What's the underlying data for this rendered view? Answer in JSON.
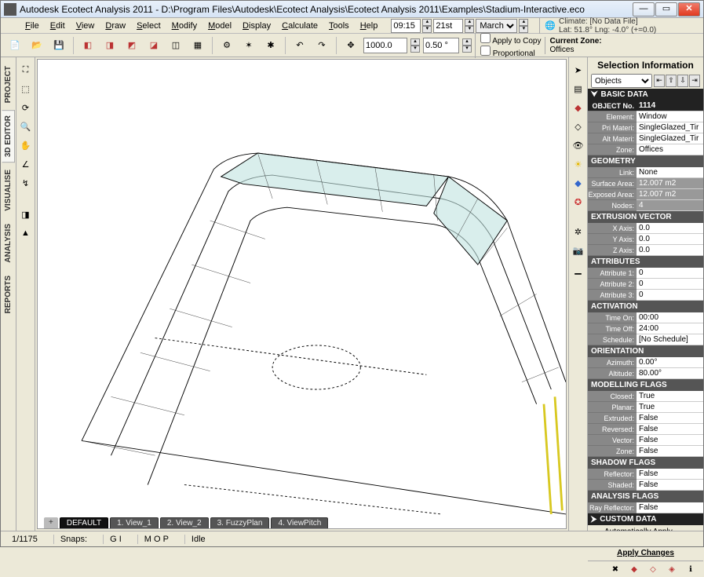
{
  "window": {
    "title": "Autodesk Ecotect Analysis 2011 - D:\\Program Files\\Autodesk\\Ecotect Analysis\\Ecotect Analysis 2011\\Examples\\Stadium-Interactive.eco"
  },
  "menu": {
    "items": [
      "File",
      "Edit",
      "View",
      "Draw",
      "Select",
      "Modify",
      "Model",
      "Display",
      "Calculate",
      "Tools",
      "Help"
    ]
  },
  "time": {
    "hour": "09:15",
    "day": "21st",
    "month": "March"
  },
  "climate": {
    "label": "Climate:",
    "line1": "[No Data File]",
    "line2": "Lat: 51.8°   Lng: -4.0° (+=0.0)"
  },
  "toolbar2": {
    "dist": "1000.0",
    "angle": "0.50 °",
    "applycopy": "Apply to Copy",
    "proportional": "Proportional",
    "czlabel": "Current Zone:",
    "czvalue": "Offices"
  },
  "leftTabs": [
    "PROJECT",
    "3D EDITOR",
    "VISUALISE",
    "ANALYSIS",
    "REPORTS"
  ],
  "viewTabs": {
    "active": "DEFAULT",
    "items": [
      "1. View_1",
      "2. View_2",
      "3. FuzzyPlan",
      "4. ViewPitch"
    ]
  },
  "sel": {
    "title": "Selection Information",
    "dropdown": "Objects",
    "basic_h": "BASIC DATA",
    "objno_l": "OBJECT No.",
    "objno_v": "1114",
    "element_l": "Element:",
    "element_v": "Window",
    "primat_l": "Pri Materi:",
    "primat_v": "SingleGlazed_Tir",
    "altmat_l": "Alt Materi:",
    "altmat_v": "SingleGlazed_Tir",
    "zone_l": "Zone:",
    "zone_v": "Offices",
    "geom_h": "GEOMETRY",
    "link_l": "Link:",
    "link_v": "None",
    "surf_l": "Surface Area: #",
    "surf_v": "12.007 m2",
    "exp_l": "Exposed Area: #",
    "exp_v": "12.007 m2",
    "nodes_l": "Nodes:",
    "nodes_v": "4",
    "extr_h": "EXTRUSION VECTOR",
    "xax_l": "X Axis:",
    "xax_v": "0.0",
    "yax_l": "Y Axis:",
    "yax_v": "0.0",
    "zax_l": "Z Axis:",
    "zax_v": "0.0",
    "attr_h": "ATTRIBUTES",
    "a1_l": "Attribute 1:",
    "a1_v": "0",
    "a2_l": "Attribute 2:",
    "a2_v": "0",
    "a3_l": "Attribute 3:",
    "a3_v": "0",
    "act_h": "ACTIVATION",
    "ton_l": "Time On:",
    "ton_v": "00:00",
    "toff_l": "Time Off:",
    "toff_v": "24:00",
    "sched_l": "Schedule:",
    "sched_v": "[No Schedule]",
    "ori_h": "ORIENTATION",
    "az_l": "Azimuth:",
    "az_v": "0.00°",
    "alt_l": "Altitude:",
    "alt_v": "80.00°",
    "mf_h": "MODELLING FLAGS",
    "closed_l": "Closed:",
    "closed_v": "True",
    "planar_l": "Planar:",
    "planar_v": "True",
    "ext_l": "Extruded:",
    "ext_v": "False",
    "rev_l": "Reversed:",
    "rev_v": "False",
    "vec_l": "Vector:",
    "vec_v": "False",
    "zonf_l": "Zone:",
    "zonf_v": "False",
    "sf_h": "SHADOW FLAGS",
    "refl_l": "Reflector:",
    "refl_v": "False",
    "shad_l": "Shaded:",
    "shad_v": "False",
    "af_h": "ANALYSIS FLAGS",
    "rref_l": "Ray Reflector:",
    "rref_v": "False",
    "cust_h": "CUSTOM DATA",
    "autoapply": "Automatically Apply Changes",
    "applybtn": "Apply Changes"
  },
  "status": {
    "count": "1/1175",
    "snaps": "Snaps:",
    "gi": "G I",
    "mop": "M O P",
    "idle": "Idle"
  }
}
